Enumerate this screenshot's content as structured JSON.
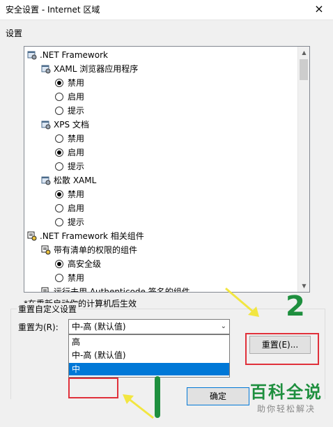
{
  "window": {
    "title": "安全设置 - Internet 区域",
    "close_glyph": "×"
  },
  "settings": {
    "group_label": "设置",
    "tree": [
      {
        "label": ".NET Framework",
        "level": 0,
        "kind": "category",
        "icon": "settings-category-icon"
      },
      {
        "label": "XAML 浏览器应用程序",
        "level": 1,
        "kind": "category",
        "icon": "settings-category-icon"
      },
      {
        "label": "禁用",
        "level": 2,
        "kind": "radio",
        "checked": true
      },
      {
        "label": "启用",
        "level": 2,
        "kind": "radio",
        "checked": false
      },
      {
        "label": "提示",
        "level": 2,
        "kind": "radio",
        "checked": false
      },
      {
        "label": "XPS 文档",
        "level": 1,
        "kind": "category",
        "icon": "settings-category-icon"
      },
      {
        "label": "禁用",
        "level": 2,
        "kind": "radio",
        "checked": false
      },
      {
        "label": "启用",
        "level": 2,
        "kind": "radio",
        "checked": true
      },
      {
        "label": "提示",
        "level": 2,
        "kind": "radio",
        "checked": false
      },
      {
        "label": "松散 XAML",
        "level": 1,
        "kind": "category",
        "icon": "settings-category-icon"
      },
      {
        "label": "禁用",
        "level": 2,
        "kind": "radio",
        "checked": true
      },
      {
        "label": "启用",
        "level": 2,
        "kind": "radio",
        "checked": false
      },
      {
        "label": "提示",
        "level": 2,
        "kind": "radio",
        "checked": false
      },
      {
        "label": ".NET Framework 相关组件",
        "level": 0,
        "kind": "category",
        "icon": "component-category-icon"
      },
      {
        "label": "带有清单的权限的组件",
        "level": 1,
        "kind": "category",
        "icon": "component-category-icon"
      },
      {
        "label": "高安全级",
        "level": 2,
        "kind": "radio",
        "checked": true
      },
      {
        "label": "禁用",
        "level": 2,
        "kind": "radio",
        "checked": false
      },
      {
        "label": "运行未用 Authenticode 签名的组件",
        "level": 1,
        "kind": "category",
        "icon": "component-category-icon"
      }
    ]
  },
  "restart_note": "*在重新启动你的计算机后生效",
  "reset": {
    "group_label": "重置自定义设置",
    "reset_to_label": "重置为(R):",
    "selected": "中-高 (默认值)",
    "options": [
      "高",
      "中-高 (默认值)",
      "中"
    ],
    "highlighted_option": "中",
    "reset_button": "重置(E)...",
    "ok_button": "确定"
  },
  "annotations": {
    "step_two": "2"
  },
  "watermark": {
    "main": "百科全说",
    "sub": "助你轻松解决"
  },
  "colors": {
    "accent": "#0078d7",
    "highlight_red": "#e0303a",
    "annotation_green": "#1e8f3e",
    "arrow_yellow": "#f2e641"
  }
}
